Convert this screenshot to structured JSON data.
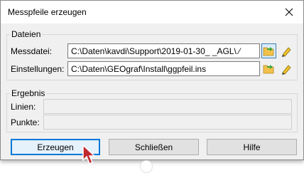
{
  "window": {
    "title": "Messpfeile erzeugen",
    "close_icon": "close-icon"
  },
  "files_group": {
    "label": "Dateien",
    "measure_file": {
      "label": "Messdatei:",
      "value": "C:\\Daten\\kavdi\\Support\\2019-01-30_ _AGL\\ ⁄"
    },
    "settings_file": {
      "label": "Einstellungen:",
      "value": "C:\\Daten\\GEOgraf\\Install\\ggpfeil.ins"
    }
  },
  "result_group": {
    "label": "Ergebnis",
    "lines_label": "Linien:",
    "lines_value": "",
    "points_label": "Punkte:",
    "points_value": ""
  },
  "buttons": {
    "create": "Erzeugen",
    "close": "Schließen",
    "help": "Hilfe"
  },
  "colors": {
    "accent": "#0078d7",
    "folder": "#f2c14b",
    "arrow": "#3aa435",
    "pencil": "#f2c230"
  }
}
